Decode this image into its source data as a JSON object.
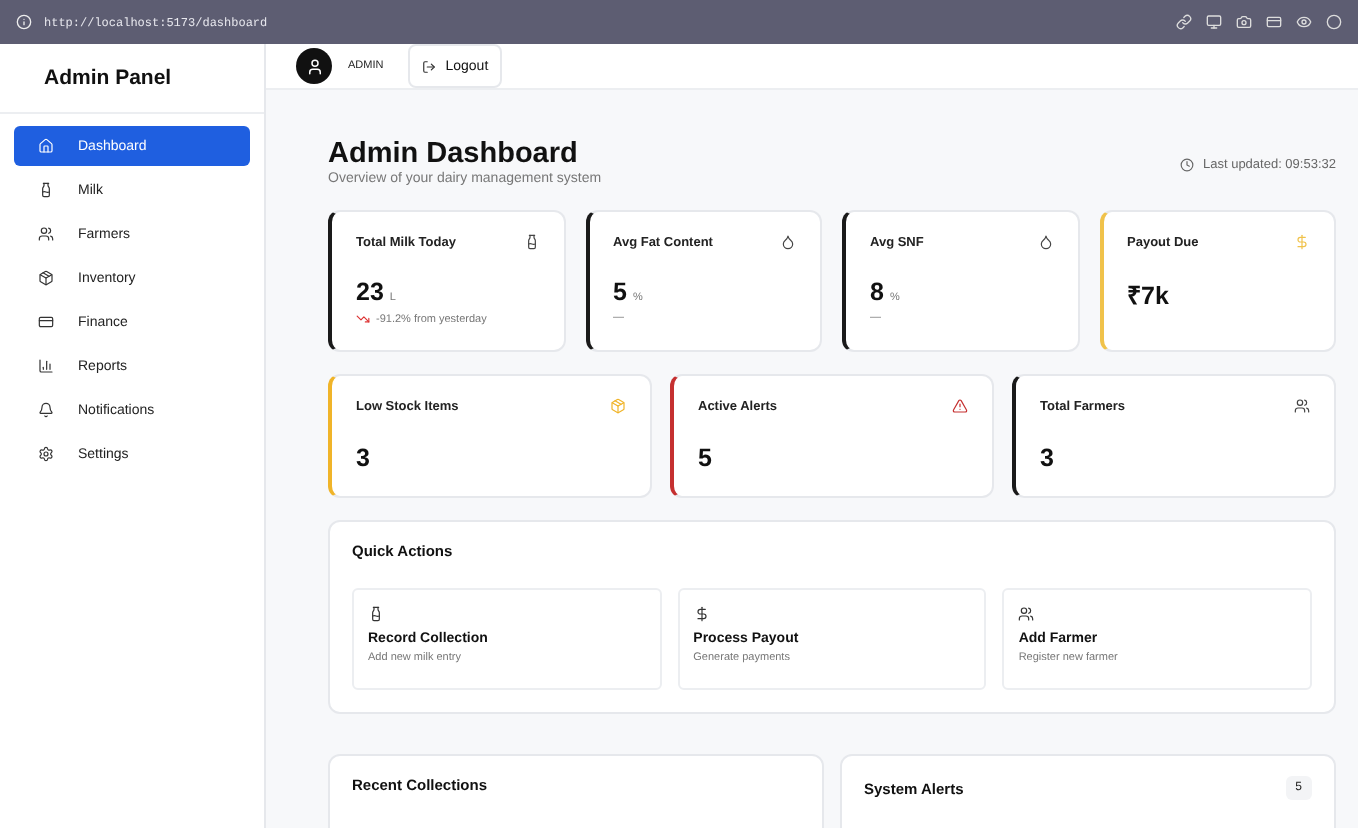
{
  "browser": {
    "url": "http://localhost:5173/dashboard"
  },
  "sidebar": {
    "title": "Admin Panel",
    "items": [
      {
        "label": "Dashboard",
        "kind": "home",
        "selected": true
      },
      {
        "label": "Milk",
        "kind": "bottle",
        "selected": false
      },
      {
        "label": "Farmers",
        "kind": "users",
        "selected": false
      },
      {
        "label": "Inventory",
        "kind": "box",
        "selected": false
      },
      {
        "label": "Finance",
        "kind": "card",
        "selected": false
      },
      {
        "label": "Reports",
        "kind": "chart",
        "selected": false
      },
      {
        "label": "Notifications",
        "kind": "bell",
        "selected": false
      },
      {
        "label": "Settings",
        "kind": "gear",
        "selected": false
      }
    ]
  },
  "header": {
    "user": "ADMIN",
    "logout": "Logout"
  },
  "page": {
    "title": "Admin Dashboard",
    "subtitle": "Overview of your dairy management system",
    "last_updated": "Last updated: 09:53:32"
  },
  "stats_top": [
    {
      "label": "Total Milk Today",
      "kind": "bottle",
      "value": "23",
      "unit": "L",
      "note": "-91.2% from yesterday",
      "trending_down": true,
      "color": "#1a1a1a"
    },
    {
      "label": "Avg Fat Content",
      "kind": "drop",
      "value": "5",
      "unit": "%",
      "note": "—",
      "trending_down": false,
      "color": "#1a1a1a"
    },
    {
      "label": "Avg SNF",
      "kind": "drop",
      "value": "8",
      "unit": "%",
      "note": "—",
      "trending_down": false,
      "color": "#1a1a1a"
    },
    {
      "label": "Payout Due",
      "kind": "dollar",
      "value": "₹7k",
      "color": "#f0c24a"
    }
  ],
  "stats_bottom": [
    {
      "label": "Low Stock Items",
      "kind": "box",
      "value": "3",
      "color": "#f0b429"
    },
    {
      "label": "Active Alerts",
      "kind": "alert",
      "value": "5",
      "color": "#c53030"
    },
    {
      "label": "Total Farmers",
      "kind": "users",
      "value": "3",
      "color": "#1a1a1a"
    }
  ],
  "quick_actions": {
    "title": "Quick Actions",
    "items": [
      {
        "kind": "bottle",
        "title": "Record Collection",
        "subtitle": "Add new milk entry"
      },
      {
        "kind": "dollar",
        "title": "Process Payout",
        "subtitle": "Generate payments"
      },
      {
        "kind": "users",
        "title": "Add Farmer",
        "subtitle": "Register new farmer"
      }
    ]
  },
  "recent_collections": {
    "title": "Recent Collections"
  },
  "system_alerts": {
    "title": "System Alerts",
    "count": "5"
  }
}
